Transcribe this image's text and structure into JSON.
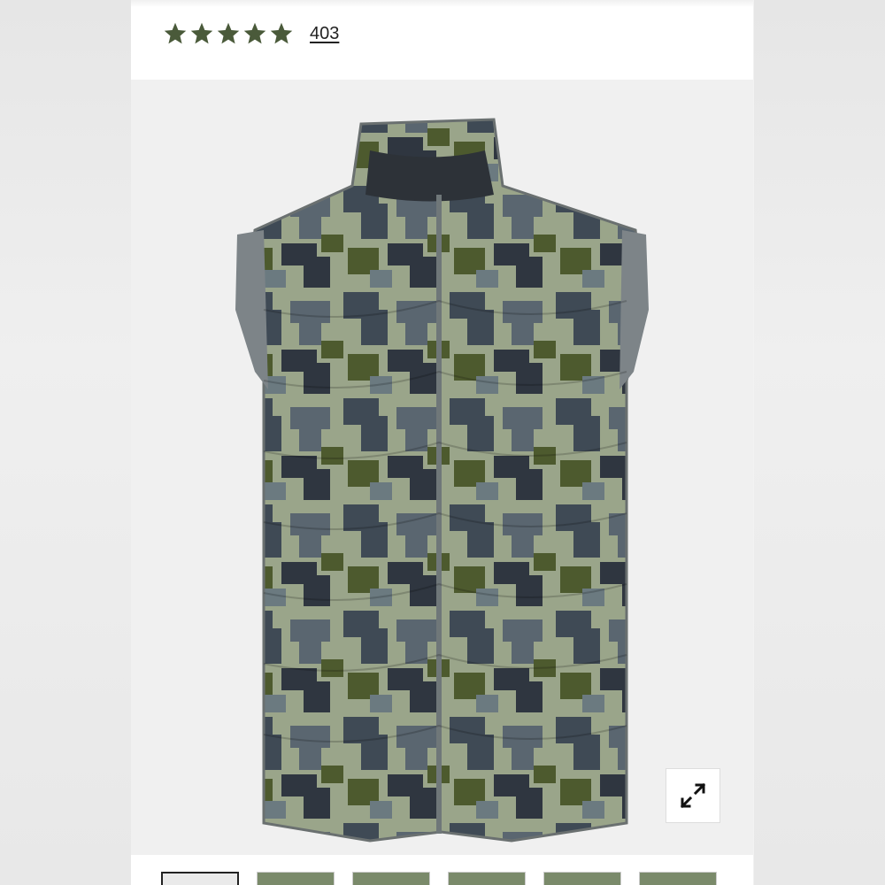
{
  "product": {
    "rating": {
      "stars": 5,
      "max": 5,
      "star_color": "#4a5a3a",
      "review_count": "403"
    },
    "image": {
      "description_icon": "camo-vest-image"
    },
    "expand_icon": "expand-icon"
  },
  "thumbnails": [
    {
      "selected": true
    },
    {
      "selected": false
    },
    {
      "selected": false
    },
    {
      "selected": false
    },
    {
      "selected": false
    },
    {
      "selected": false
    }
  ]
}
